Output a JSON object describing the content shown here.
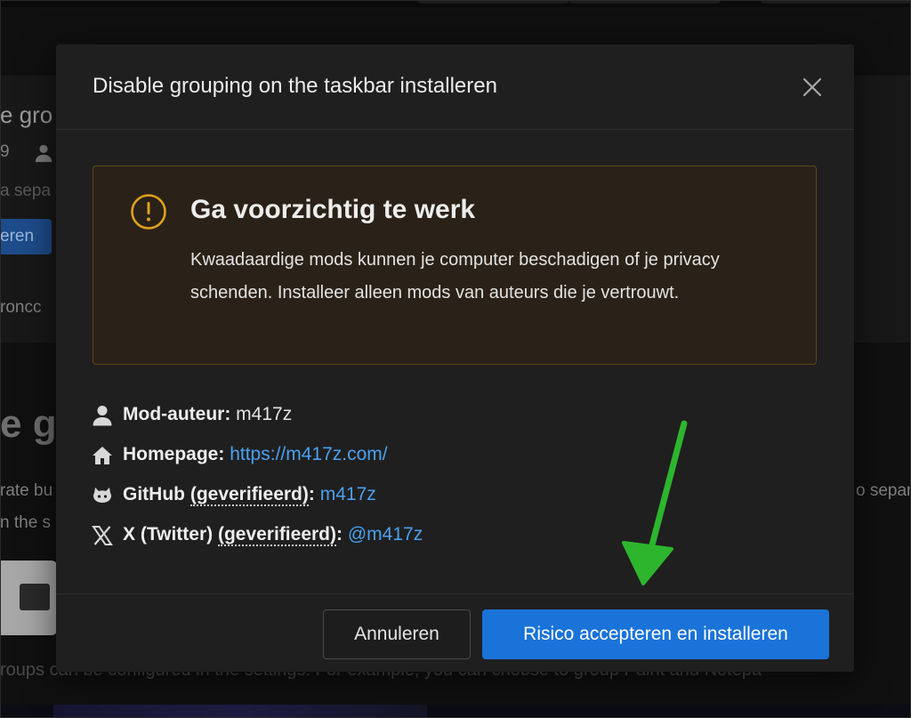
{
  "background_page": {
    "frag_title": "e gro",
    "frag_num": "9",
    "frag_sub": "a sepa",
    "frag_button": "eren",
    "frag_line": "roncc",
    "frag_big": "e gr",
    "frag_line2": "rate bu",
    "frag_line3": "n the s",
    "frag_right": "o separ",
    "frag_bottom": "roups can be configured in the settings. For example, you can choose to group Paint and Notepa"
  },
  "modal": {
    "title": "Disable grouping on the taskbar installeren",
    "close_icon": "close-icon"
  },
  "warning": {
    "icon": "exclamation-circle-icon",
    "title": "Ga voorzichtig te werk",
    "text": "Kwaadaardige mods kunnen je computer beschadigen of je privacy schenden. Installeer alleen mods van auteurs die je vertrouwt.",
    "accent_color": "#e0a020"
  },
  "info": {
    "author": {
      "icon": "user-icon",
      "label": "Mod-auteur:",
      "value": "m417z"
    },
    "homepage": {
      "icon": "home-icon",
      "label": "Homepage:",
      "value": "https://m417z.com/"
    },
    "github": {
      "icon": "github-icon",
      "label_main": "GitHub",
      "label_verified": "(geverifieerd)",
      "label_colon": ":",
      "value": "m417z"
    },
    "twitter": {
      "icon": "x-twitter-icon",
      "label_main": "X (Twitter)",
      "label_verified": "(geverifieerd)",
      "label_colon": ":",
      "value": "@m417z"
    }
  },
  "footer": {
    "cancel_label": "Annuleren",
    "accept_label": "Risico accepteren en installeren",
    "accept_color": "#1a73d8"
  },
  "annotation": {
    "arrow_icon": "green-arrow-icon",
    "arrow_color": "#2db52d"
  }
}
